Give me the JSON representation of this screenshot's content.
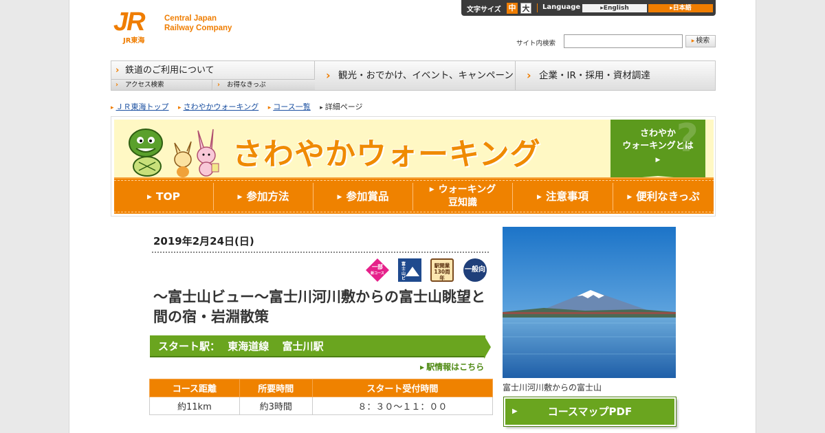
{
  "header": {
    "logo_mark": "JR",
    "logo_sub": "JR東海",
    "company_en_line1": "Central Japan",
    "company_en_line2": "Railway Company"
  },
  "topbar": {
    "font_size_label": "文字サイズ",
    "font_mid": "中",
    "font_big": "大",
    "language_label": "Language",
    "lang_en": "English",
    "lang_ja": "日本語"
  },
  "search": {
    "label": "サイト内検索",
    "placeholder": "",
    "button": "検索"
  },
  "global_nav": {
    "railway": "鉄道のご利用について",
    "access": "アクセス検索",
    "tickets": "お得なきっぷ",
    "tourism": "観光・おでかけ、イベント、キャンペーン",
    "corporate": "企業・IR・採用・資材調達"
  },
  "breadcrumb": [
    "ＪＲ東海トップ",
    "さわやかウォーキング",
    "コース一覧",
    "詳細ページ"
  ],
  "banner": {
    "title": "さわやかウォーキング",
    "about_line1": "さわやか",
    "about_line2": "ウォーキングとは",
    "nav": [
      "TOP",
      "参加方法",
      "参加賞品",
      "ウォーキング",
      "豆知識",
      "注意事項",
      "便利なきっぷ"
    ]
  },
  "event": {
    "date": "2019年2月24日(日)",
    "badges": {
      "partial_new_1": "一部",
      "partial_new_2": "新コース",
      "fuji_view": "富士山ビュー",
      "station_1": "駅開業",
      "station_2": "130周年",
      "general": "一般向"
    },
    "title": "～富士山ビュー～富士川河川敷からの富士山眺望と間の宿・岩淵散策",
    "start_label": "スタート駅：",
    "start_line": "東海道線",
    "start_station": "富士川駅",
    "station_info_link": "駅情報はこちら",
    "table": {
      "headers": [
        "コース距離",
        "所要時間",
        "スタート受付時間"
      ],
      "values": [
        "約11km",
        "約3時間",
        "８：３０～１１：００"
      ]
    },
    "photo_caption": "富士川河川敷からの富士山",
    "pdf_button": "コースマップPDF"
  },
  "colors": {
    "brand_orange": "#ef8200",
    "accent_green": "#6aa51f",
    "banner_yellow": "#fff8c4"
  }
}
